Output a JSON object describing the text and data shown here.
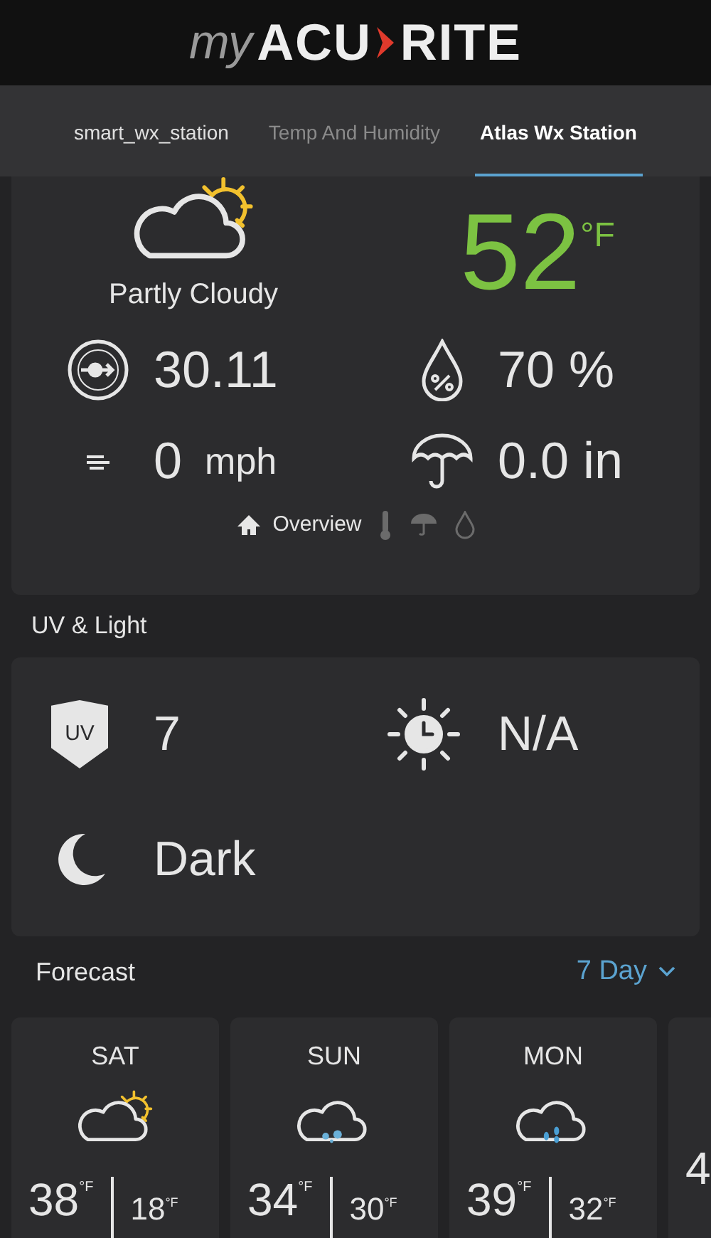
{
  "logo": {
    "prefix": "my",
    "left": "ACU",
    "right": "RITE"
  },
  "tabs": [
    {
      "label": "smart_wx_station",
      "selected": false,
      "dim": false
    },
    {
      "label": "Temp And Humidity",
      "selected": false,
      "dim": true
    },
    {
      "label": "Atlas Wx Station",
      "selected": true,
      "dim": false
    }
  ],
  "current": {
    "condition": "Partly Cloudy",
    "temperature": "52",
    "temperature_unit": "°F",
    "stats": [
      {
        "kind": "pressure",
        "value": "30.11"
      },
      {
        "kind": "humidity",
        "value": "70 %"
      },
      {
        "kind": "wind",
        "value": "0",
        "unit": "mph"
      },
      {
        "kind": "rain",
        "value": "0.0 in"
      }
    ],
    "pager": [
      {
        "kind": "overview",
        "label": "Overview",
        "selected": true
      },
      {
        "kind": "thermometer",
        "selected": false
      },
      {
        "kind": "umbrella",
        "selected": false
      },
      {
        "kind": "drop",
        "selected": false
      }
    ]
  },
  "uv_light": {
    "title": "UV & Light",
    "items": [
      {
        "kind": "uv",
        "badge": "UV",
        "value": "7"
      },
      {
        "kind": "sun-clock",
        "value": "N/A"
      },
      {
        "kind": "moon",
        "value": "Dark"
      }
    ]
  },
  "forecast": {
    "title": "Forecast",
    "range": "7 Day",
    "days": [
      {
        "day": "SAT",
        "kind": "partly-cloudy",
        "high": "38",
        "high_unit": "°F",
        "low": "18",
        "low_unit": "°F"
      },
      {
        "day": "SUN",
        "kind": "snow",
        "high": "34",
        "high_unit": "°F",
        "low": "30",
        "low_unit": "°F"
      },
      {
        "day": "MON",
        "kind": "rain",
        "high": "39",
        "high_unit": "°F",
        "low": "32",
        "low_unit": "°F"
      },
      {
        "high": "4"
      }
    ]
  }
}
